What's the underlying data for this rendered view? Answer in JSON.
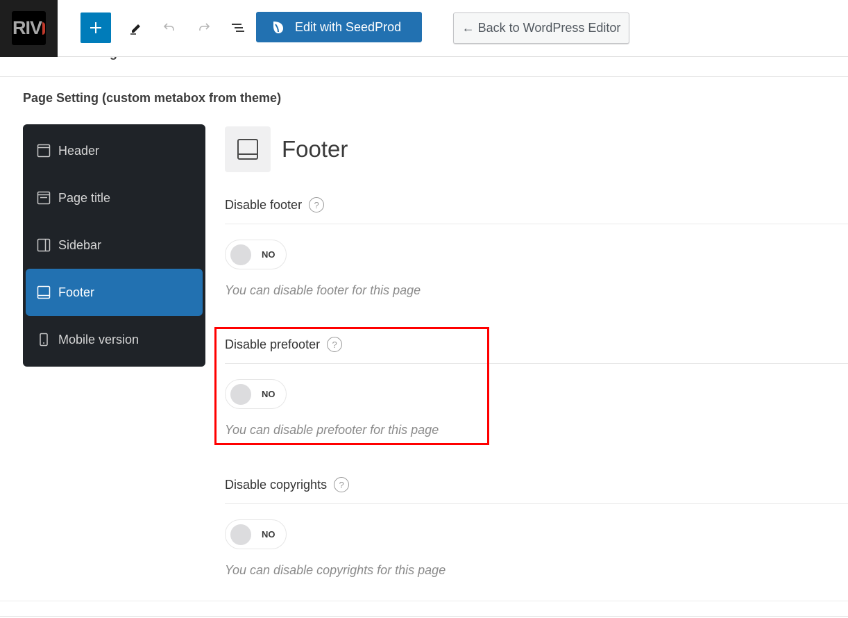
{
  "toolbar": {
    "logo_text": "RIV",
    "add_block_label": "+",
    "seedprod_label": "Edit with SeedProd",
    "back_label": "← Back to WordPress Editor",
    "icons": [
      "plus-icon",
      "pencil-icon",
      "undo-icon",
      "redo-icon",
      "list-view-icon",
      "seedprod-leaf-icon"
    ]
  },
  "aioseo_label": "AIOSEO Settings",
  "page_setting": {
    "title": "Page Setting (custom metabox from theme)",
    "nav": [
      {
        "label": "Header",
        "icon": "header-layout-icon",
        "active": false
      },
      {
        "label": "Page title",
        "icon": "page-title-layout-icon",
        "active": false
      },
      {
        "label": "Sidebar",
        "icon": "sidebar-layout-icon",
        "active": false
      },
      {
        "label": "Footer",
        "icon": "footer-layout-icon",
        "active": true
      },
      {
        "label": "Mobile version",
        "icon": "mobile-icon",
        "active": false
      }
    ],
    "panel": {
      "title": "Footer",
      "icon": "footer-layout-icon",
      "settings": [
        {
          "label": "Disable footer",
          "toggle": "NO",
          "description": "You can disable footer for this page",
          "highlighted": false
        },
        {
          "label": "Disable prefooter",
          "toggle": "NO",
          "description": "You can disable prefooter for this page",
          "highlighted": true
        },
        {
          "label": "Disable copyrights",
          "toggle": "NO",
          "description": "You can disable copyrights for this page",
          "highlighted": false
        }
      ]
    }
  },
  "colors": {
    "accent": "#2271b1",
    "inserter": "#007cba",
    "sidebar_bg": "#1f2328",
    "highlight": "#ff0000"
  }
}
